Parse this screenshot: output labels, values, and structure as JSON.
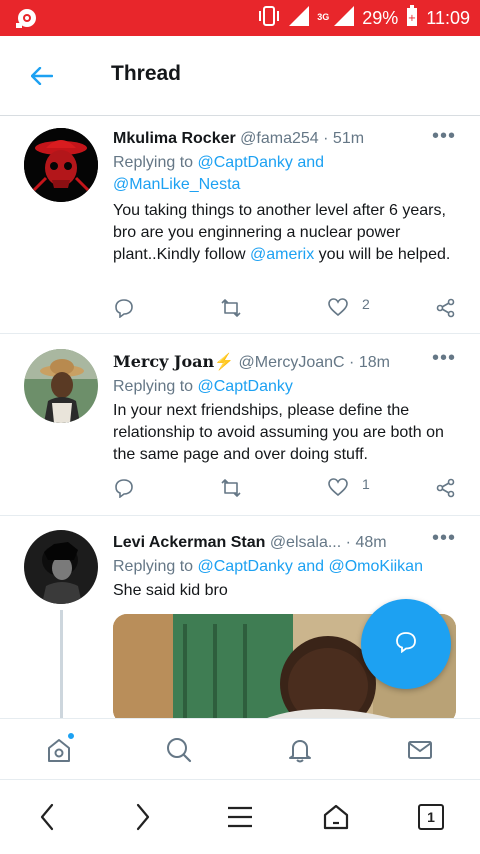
{
  "status_bar": {
    "network": "3G",
    "battery": "29%",
    "time": "11:09"
  },
  "header": {
    "title": "Thread"
  },
  "tweets": [
    {
      "name": "Mkulima Rocker",
      "handle": "@fama254",
      "separator": "·",
      "time": "51m",
      "replying_prefix": "Replying to ",
      "replying_to": "@CaptDanky and",
      "replying_to_2": "@ManLike_Nesta",
      "text_1": "You taking things to another level after 6 years, bro are you enginnering a nuclear power plant..Kindly follow ",
      "mention": "@amerix",
      "text_2": " you will be helped.",
      "likes": "2"
    },
    {
      "name": "Mercy Joan⚡",
      "handle": "@MercyJoanC",
      "separator": "·",
      "time": "18m",
      "replying_prefix": "Replying to ",
      "replying_to": "@CaptDanky",
      "text": "In your next friendships, please define the relationship to avoid assuming you are both on the same page and over doing stuff.",
      "likes": "1"
    },
    {
      "name": "Levi Ackerman Stan",
      "handle": "@elsala...",
      "separator": "·",
      "time": "48m",
      "replying_prefix": "Replying to ",
      "replying_to": "@CaptDanky and @OmoKiikan",
      "text": "She said kid bro"
    }
  ],
  "browser": {
    "tab_count": "1"
  },
  "colors": {
    "status_bar": "#e8262b",
    "accent": "#1da1f2",
    "secondary_text": "#657786"
  },
  "icons": {
    "status_left": "camera-icon",
    "back": "back-arrow-icon",
    "more": "more-icon",
    "reply": "reply-icon",
    "retweet": "retweet-icon",
    "like": "heart-icon",
    "share": "share-icon",
    "compose": "compose-icon",
    "home": "home-icon",
    "search": "search-icon",
    "notifications": "bell-icon",
    "messages": "mail-icon"
  }
}
